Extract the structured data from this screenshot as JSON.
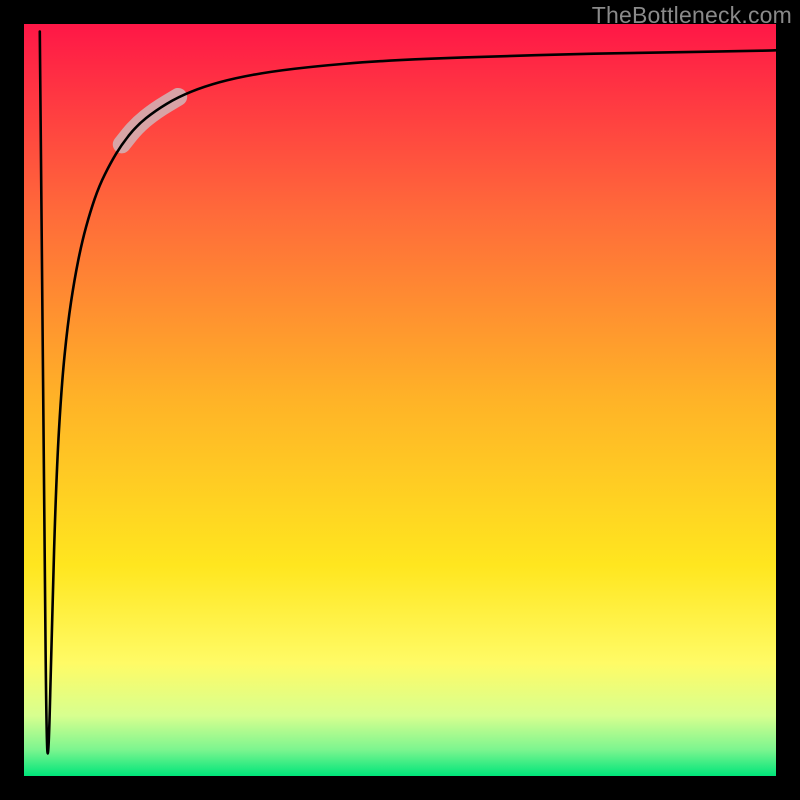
{
  "attribution": "TheBottleneck.com",
  "chart_data": {
    "type": "line",
    "title": "",
    "xlabel": "",
    "ylabel": "",
    "xlim": [
      0,
      100
    ],
    "ylim": [
      0,
      100
    ],
    "background_gradient": {
      "stops": [
        {
          "offset": 0.0,
          "color": "#ff1747"
        },
        {
          "offset": 0.25,
          "color": "#ff6a3a"
        },
        {
          "offset": 0.5,
          "color": "#ffb327"
        },
        {
          "offset": 0.72,
          "color": "#ffe61f"
        },
        {
          "offset": 0.85,
          "color": "#fffb66"
        },
        {
          "offset": 0.92,
          "color": "#d7ff8f"
        },
        {
          "offset": 0.965,
          "color": "#7cf58f"
        },
        {
          "offset": 1.0,
          "color": "#00e57a"
        }
      ]
    },
    "frame_color": "#000000",
    "frame_thickness": 24,
    "curve": {
      "color": "#000000",
      "width": 2.6,
      "x": [
        2.1,
        2.7,
        3.0,
        3.3,
        3.7,
        4.3,
        5.0,
        5.8,
        6.7,
        7.7,
        8.8,
        10.0,
        11.5,
        13.0,
        15.0,
        17.5,
        20.5,
        24.0,
        28.0,
        33.0,
        39.0,
        46.0,
        54.0,
        63.0,
        73.0,
        84.0,
        96.0,
        100.0
      ],
      "y": [
        99.0,
        35.0,
        3.0,
        3.0,
        20.0,
        40.0,
        52.0,
        60.0,
        66.0,
        71.0,
        75.0,
        78.5,
        81.5,
        84.0,
        86.5,
        88.5,
        90.3,
        91.7,
        92.8,
        93.7,
        94.4,
        95.0,
        95.4,
        95.7,
        96.0,
        96.2,
        96.4,
        96.5
      ]
    },
    "highlight": {
      "color": "#d4aeb1",
      "width": 18,
      "x_range": [
        13.0,
        20.5
      ],
      "x": [
        13.0,
        15.0,
        17.5,
        20.5
      ],
      "y": [
        84.0,
        86.5,
        88.5,
        90.3
      ]
    }
  }
}
